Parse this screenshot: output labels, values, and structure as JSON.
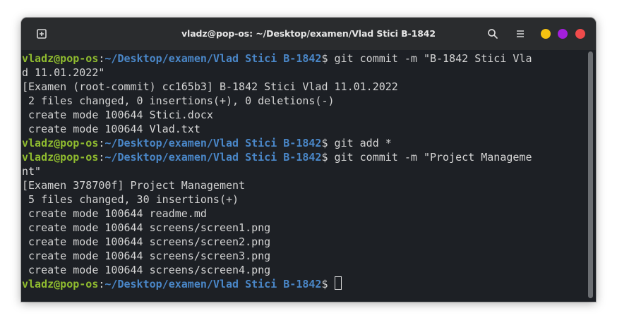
{
  "window": {
    "title": "vladz@pop-os: ~/Desktop/examen/Vlad Stici B-1842",
    "icons": {
      "new_tab": "new-tab-icon",
      "search": "search-icon",
      "menu": "hamburger-menu-icon",
      "minimize": "minimize-dot-icon",
      "maximize": "maximize-dot-icon",
      "close": "close-dot-icon"
    },
    "colors": {
      "minimize": "#f5c211",
      "maximize": "#a21fdc",
      "close": "#ef4b4b"
    }
  },
  "terminal": {
    "prompt_user": "vladz@pop-os",
    "prompt_path": "~/Desktop/examen/Vlad Stici B-1842",
    "colors": {
      "user": "#8fbb2f",
      "path": "#4a87c8",
      "text": "#d4d4d4",
      "background": "#1d2025"
    },
    "lines": [
      {
        "prompt": true,
        "text": "$ git commit -m \"B-1842 Stici Vla"
      },
      {
        "prompt": false,
        "text": "d 11.01.2022\""
      },
      {
        "prompt": false,
        "text": "[Examen (root-commit) cc165b3] B-1842 Stici Vlad 11.01.2022"
      },
      {
        "prompt": false,
        "text": " 2 files changed, 0 insertions(+), 0 deletions(-)"
      },
      {
        "prompt": false,
        "text": " create mode 100644 Stici.docx"
      },
      {
        "prompt": false,
        "text": " create mode 100644 Vlad.txt"
      },
      {
        "prompt": true,
        "text": "$ git add *"
      },
      {
        "prompt": true,
        "text": "$ git commit -m \"Project Manageme"
      },
      {
        "prompt": false,
        "text": "nt\""
      },
      {
        "prompt": false,
        "text": "[Examen 378700f] Project Management"
      },
      {
        "prompt": false,
        "text": " 5 files changed, 30 insertions(+)"
      },
      {
        "prompt": false,
        "text": " create mode 100644 readme.md"
      },
      {
        "prompt": false,
        "text": " create mode 100644 screens/screen1.png"
      },
      {
        "prompt": false,
        "text": " create mode 100644 screens/screen2.png"
      },
      {
        "prompt": false,
        "text": " create mode 100644 screens/screen3.png"
      },
      {
        "prompt": false,
        "text": " create mode 100644 screens/screen4.png"
      },
      {
        "prompt": true,
        "text": "$ ",
        "cursor": true
      }
    ]
  }
}
